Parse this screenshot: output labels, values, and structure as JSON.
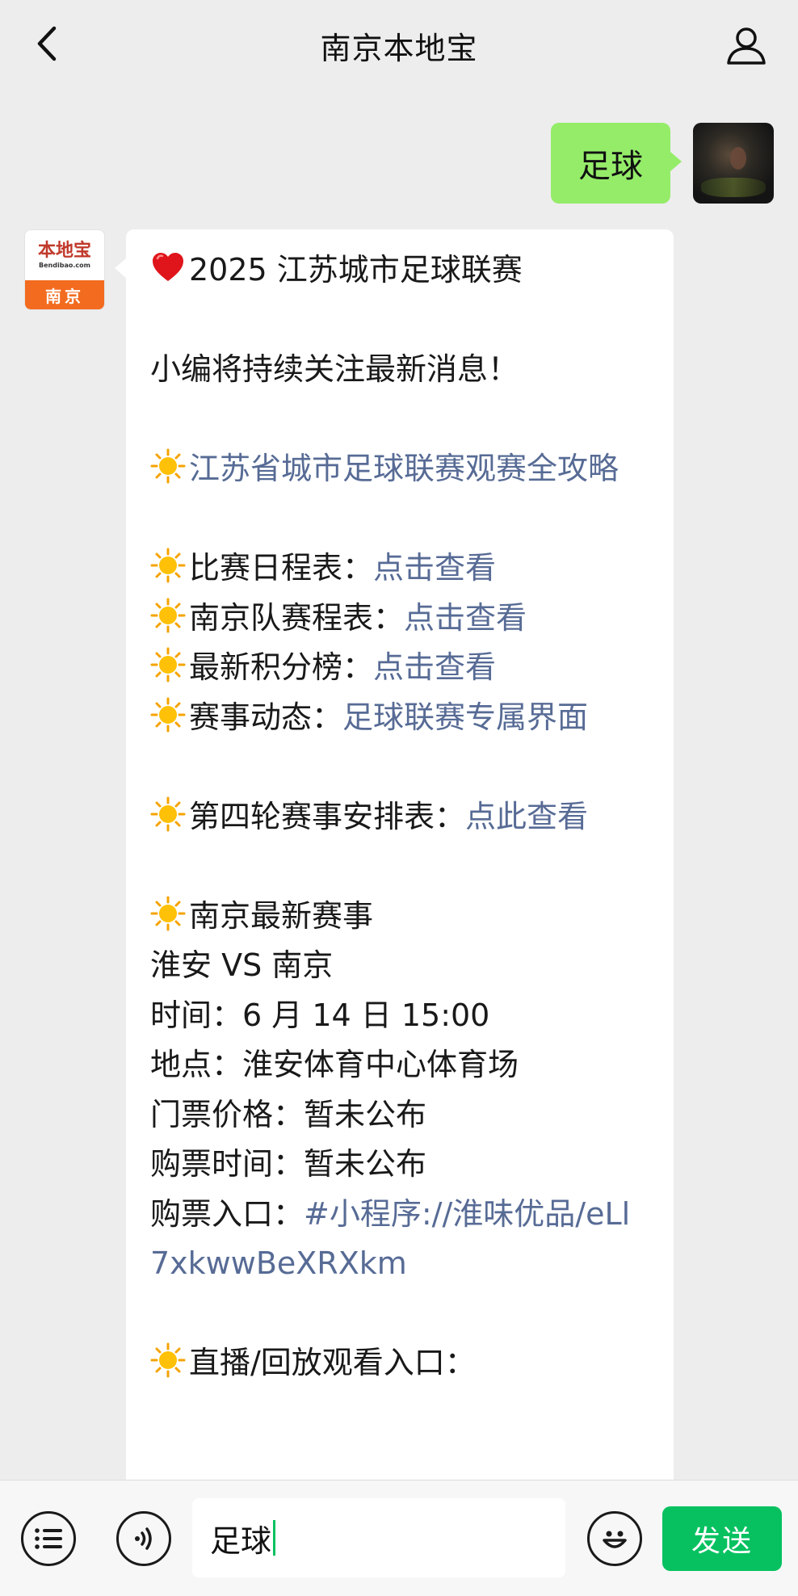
{
  "header": {
    "title": "南京本地宝"
  },
  "outgoing": {
    "text": "足球"
  },
  "brand_avatar": {
    "logo_text": "本地宝",
    "url": "Bendibao.com",
    "city": "南京"
  },
  "message": {
    "title": "2025 江苏城市足球联赛",
    "intro": "小编将持续关注最新消息！",
    "guide_link": "江苏省城市足球联赛观赛全攻略",
    "schedule_label": "比赛日程表：",
    "schedule_link": "点击查看",
    "nanjing_label": "南京队赛程表：",
    "nanjing_link": "点击查看",
    "ranking_label": "最新积分榜：",
    "ranking_link": "点击查看",
    "news_label": "赛事动态：",
    "news_link": "足球联赛专属界面",
    "round4_label": "第四轮赛事安排表：",
    "round4_link": "点此查看",
    "latest_label": "南京最新赛事",
    "match": "淮安 VS 南京",
    "time": "时间：6 月 14 日 15:00",
    "venue": "地点：淮安体育中心体育场",
    "price": "门票价格：暂未公布",
    "buy_time": "购票时间：暂未公布",
    "buy_label": "购票入口：",
    "buy_link": "#小程序://淮味优品/eLl7xkwwBeXRXkm",
    "live_label": "直播/回放观看入口："
  },
  "input": {
    "value": "足球",
    "send_label": "发送"
  },
  "colors": {
    "bubble_out": "#95ec69",
    "link": "#576b95",
    "send": "#07c160",
    "brand_orange": "#f26b1f"
  },
  "icons": [
    "back-icon",
    "user-icon",
    "heart-icon",
    "sun-icon",
    "list-icon",
    "voice-icon",
    "emoji-icon"
  ]
}
